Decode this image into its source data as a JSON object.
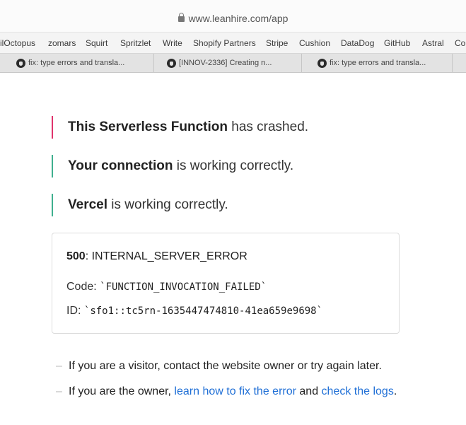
{
  "browser": {
    "url": "www.leanhire.com/app",
    "bookmarks": [
      "ilOctopus",
      "zomars",
      "Squirt",
      "Spritzlet",
      "Write",
      "Shopify Partners",
      "Stripe",
      "Cushion",
      "DataDog",
      "GitHub",
      "Astral",
      "Co"
    ],
    "tabs": [
      "fix: type errors and transla...",
      "[INNOV-2336] Creating n...",
      "fix: type errors and transla..."
    ]
  },
  "status": [
    {
      "strong": "This Serverless Function",
      "rest": " has crashed.",
      "state": "error",
      "color": "#e0336c"
    },
    {
      "strong": "Your connection",
      "rest": " is working correctly.",
      "state": "ok",
      "color": "#3fb08f"
    },
    {
      "strong": "Vercel",
      "rest": " is working correctly.",
      "state": "ok",
      "color": "#3fb08f"
    }
  ],
  "error": {
    "status_code": "500",
    "status_name": ": INTERNAL_SERVER_ERROR",
    "code_label": "Code: ",
    "code_value": "`FUNCTION_INVOCATION_FAILED`",
    "id_label": "ID: ",
    "id_value": "`sfo1::tc5rn-1635447474810-41ea659e9698`"
  },
  "help": {
    "dash": "–",
    "visitor": "If you are a visitor, contact the website owner or try again later.",
    "owner_prefix": "If you are the owner, ",
    "fix_link": "learn how to fix the error",
    "and": " and ",
    "logs_link": "check the logs",
    "suffix": "."
  },
  "colors": {
    "link": "#1f6fd6",
    "crash": "#e0336c",
    "ok": "#3fb08f"
  }
}
